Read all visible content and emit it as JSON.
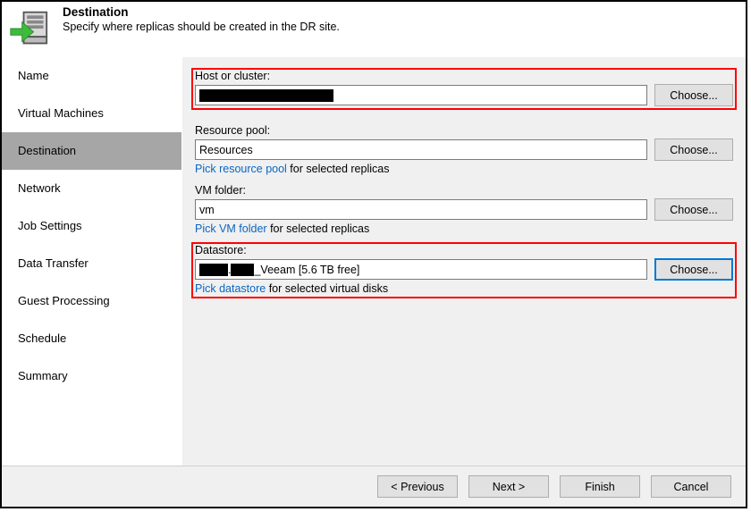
{
  "header": {
    "title": "Destination",
    "subtitle": "Specify where replicas should be created in the DR site."
  },
  "sidebar": {
    "items": [
      {
        "label": "Name"
      },
      {
        "label": "Virtual Machines"
      },
      {
        "label": "Destination",
        "selected": true
      },
      {
        "label": "Network"
      },
      {
        "label": "Job Settings"
      },
      {
        "label": "Data Transfer"
      },
      {
        "label": "Guest Processing"
      },
      {
        "label": "Schedule"
      },
      {
        "label": "Summary"
      }
    ]
  },
  "content": {
    "host": {
      "label": "Host or cluster:",
      "value": "",
      "choose": "Choose..."
    },
    "pool": {
      "label": "Resource pool:",
      "value": "Resources",
      "choose": "Choose...",
      "pick_link": "Pick resource pool",
      "pick_rest": " for selected replicas"
    },
    "folder": {
      "label": "VM folder:",
      "value": "vm",
      "choose": "Choose...",
      "pick_link": "Pick VM folder",
      "pick_rest": " for selected replicas"
    },
    "datastore": {
      "label": "Datastore:",
      "value_suffix": "_Veeam [5.6 TB free]",
      "choose": "Choose...",
      "pick_link": "Pick datastore",
      "pick_rest": " for selected virtual disks"
    }
  },
  "footer": {
    "previous": "< Previous",
    "next": "Next >",
    "finish": "Finish",
    "cancel": "Cancel"
  }
}
